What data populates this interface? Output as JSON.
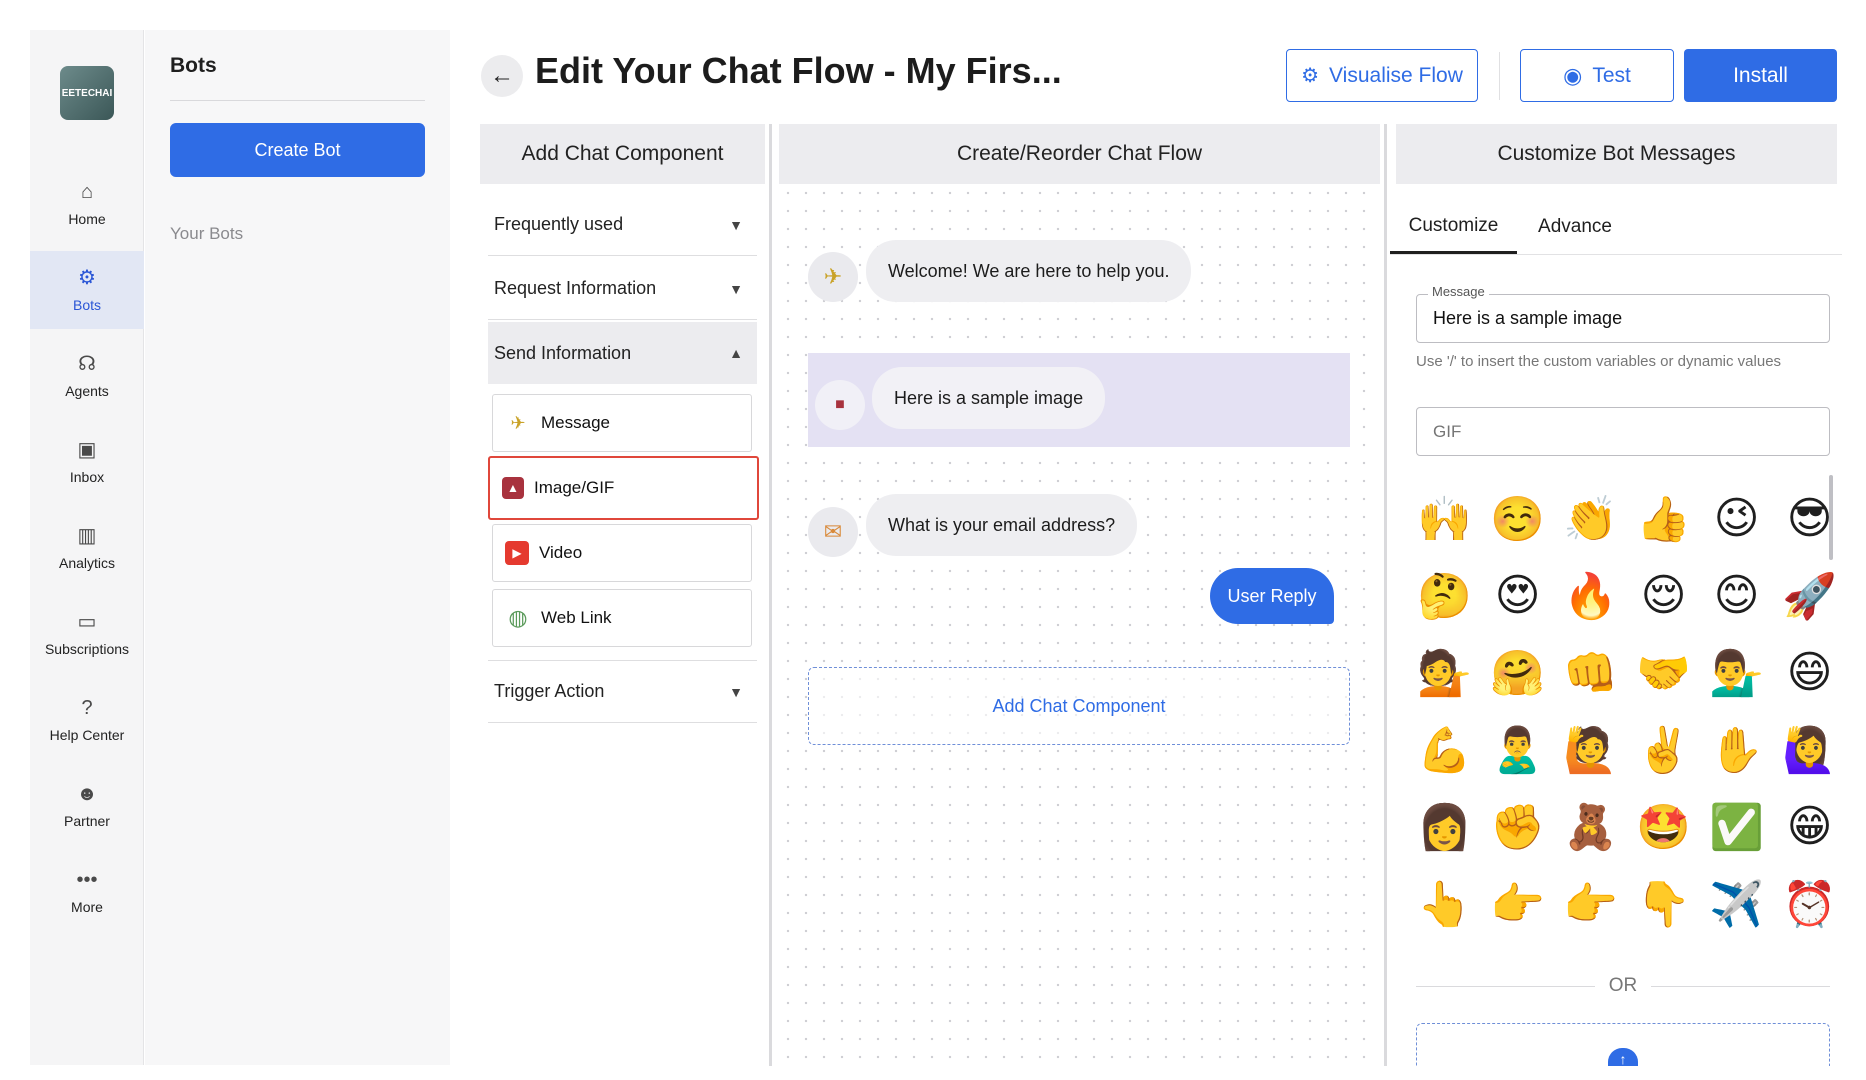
{
  "rail": {
    "logo_text": "EETECHAI",
    "items": [
      {
        "label": "Home",
        "icon": "home-icon",
        "glyph": "⌂",
        "active": false
      },
      {
        "label": "Bots",
        "icon": "bots-icon",
        "glyph": "⚙",
        "active": true
      },
      {
        "label": "Agents",
        "icon": "headset-icon",
        "glyph": "☊",
        "active": false
      },
      {
        "label": "Inbox",
        "icon": "inbox-icon",
        "glyph": "▣",
        "active": false
      },
      {
        "label": "Analytics",
        "icon": "analytics-icon",
        "glyph": "▥",
        "active": false
      },
      {
        "label": "Subscriptions",
        "icon": "subscriptions-icon",
        "glyph": "▭",
        "active": false
      },
      {
        "label": "Help Center",
        "icon": "help-icon",
        "glyph": "?",
        "active": false
      },
      {
        "label": "Partner",
        "icon": "partner-icon",
        "glyph": "☻",
        "active": false
      },
      {
        "label": "More",
        "icon": "more-icon",
        "glyph": "•••",
        "active": false
      }
    ]
  },
  "bots_panel": {
    "title": "Bots",
    "create_label": "Create Bot",
    "your_bots_label": "Your Bots"
  },
  "header": {
    "title": "Edit Your Chat Flow - My Firs...",
    "visualise_label": "Visualise Flow",
    "test_label": "Test",
    "install_label": "Install"
  },
  "columns": {
    "components": "Add Chat Component",
    "flow": "Create/Reorder Chat Flow",
    "customize": "Customize Bot Messages"
  },
  "components": {
    "frequently_used": "Frequently used",
    "request_information": "Request Information",
    "send_information": "Send Information",
    "trigger_action": "Trigger Action",
    "items": [
      {
        "label": "Message",
        "glyph": "✈",
        "color": "#c9a227"
      },
      {
        "label": "Image/GIF",
        "glyph": "▲",
        "color": "#a8323e"
      },
      {
        "label": "Video",
        "glyph": "▶",
        "color": "#e53a2f"
      },
      {
        "label": "Web Link",
        "glyph": "◍",
        "color": "#5a9a5a"
      }
    ]
  },
  "flow": {
    "welcome": "Welcome! We are here to help you.",
    "image_msg": "Here is a sample image",
    "email_q": "What is your email address?",
    "user_reply": "User Reply",
    "add_component": "Add Chat Component"
  },
  "customize": {
    "tab_customize": "Customize",
    "tab_advance": "Advance",
    "message_label": "Message",
    "message_value": "Here is a sample image",
    "hint": "Use '/' to insert the custom variables or dynamic values",
    "gif_placeholder": "GIF",
    "or_label": "OR",
    "emojis": [
      "🙌",
      "☺️",
      "👏",
      "👍",
      "😉",
      "😎",
      "🤔",
      "😍",
      "🔥",
      "😌",
      "😊",
      "🚀",
      "💁",
      "🤗",
      "👊",
      "🤝",
      "💁‍♂️",
      "😄",
      "💪",
      "🙎‍♂️",
      "🙋",
      "✌️",
      "✋",
      "🙋‍♀️",
      "👩",
      "✊",
      "🧸",
      "🤩",
      "✅",
      "😁",
      "👆",
      "👉",
      "👉",
      "👇",
      "✈️",
      "⏰"
    ]
  }
}
